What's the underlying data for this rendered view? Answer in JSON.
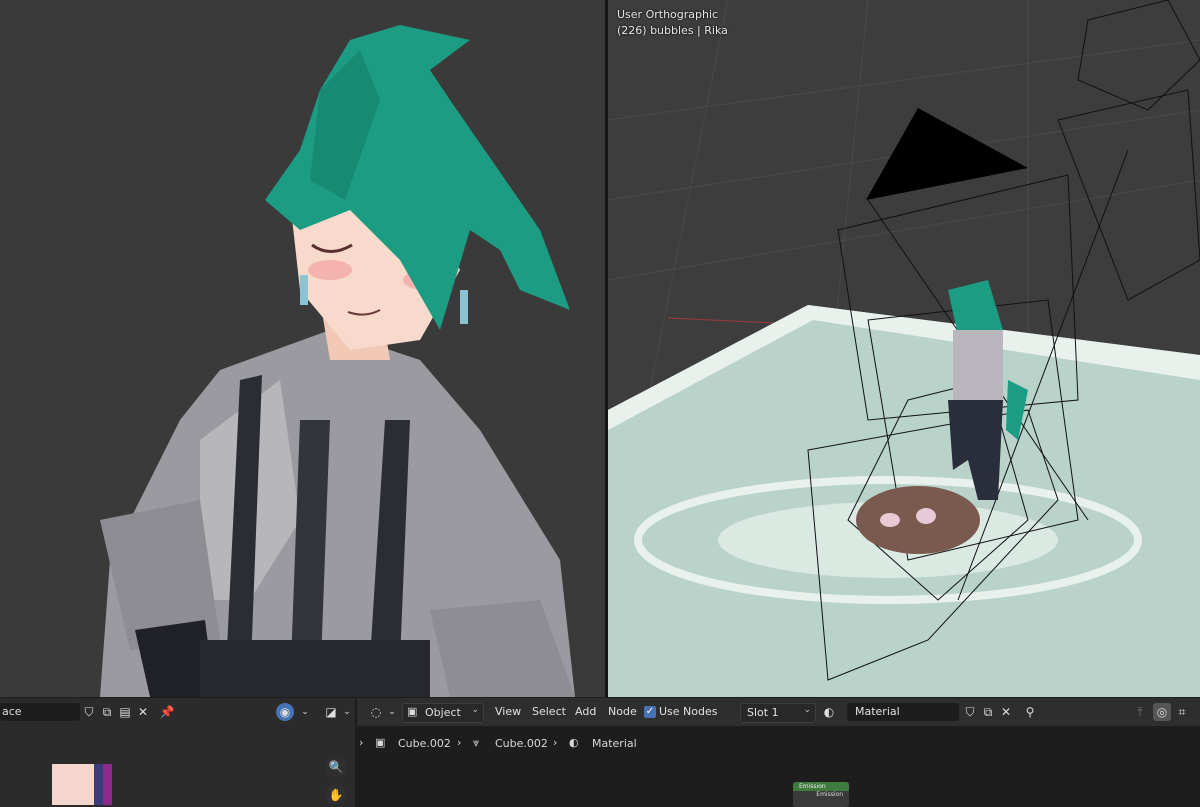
{
  "viewport_right": {
    "view_name": "User Orthographic",
    "collection_info": "(226) bubbles | Rika"
  },
  "image_editor": {
    "image_name_field": "ace",
    "icons": [
      "shield-icon",
      "duplicate-icon",
      "folder-icon",
      "close-icon",
      "pin-icon",
      "render-slot-icon",
      "display-channels-icon"
    ]
  },
  "node_editor": {
    "editor_type_icon": "shader-editor-icon",
    "object_mode": "Object",
    "menus": [
      "View",
      "Select",
      "Add",
      "Node"
    ],
    "use_nodes_label": "Use Nodes",
    "use_nodes_checked": true,
    "slot": "Slot 1",
    "material_name": "Material",
    "breadcrumbs": [
      "Cube.002",
      "Cube.002",
      "Material"
    ],
    "node_title": "Emission",
    "node_output": "Emission"
  },
  "colors": {
    "viewport_bg": "#3a3a3a",
    "header_bg": "#2e2e2e",
    "accent_blue": "#4772b3",
    "hair_green": "#1f9e86",
    "field_green": "#b9d2ca"
  }
}
